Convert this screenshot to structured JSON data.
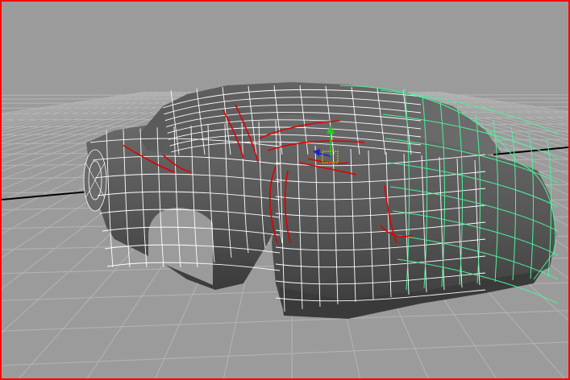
{
  "viewport": {
    "active_border_color": "#ff0000",
    "background_color": "#9b9b9b",
    "grid_color": "#b4b4b4",
    "axis_color": "#000000"
  },
  "model": {
    "shape": "sedan-car-body",
    "shading": "smooth-shaded-with-wireframe",
    "base_color": "#5a5a5a",
    "wireframe_color": "#ffffff",
    "selected_edge_color": "#e00000",
    "selected_object_wire_color": "#4cf29a"
  },
  "manipulator": {
    "type": "move",
    "y_axis_color": "#22cc22",
    "z_axis_color": "#1f1fd6",
    "center_color": "#d8d800"
  }
}
